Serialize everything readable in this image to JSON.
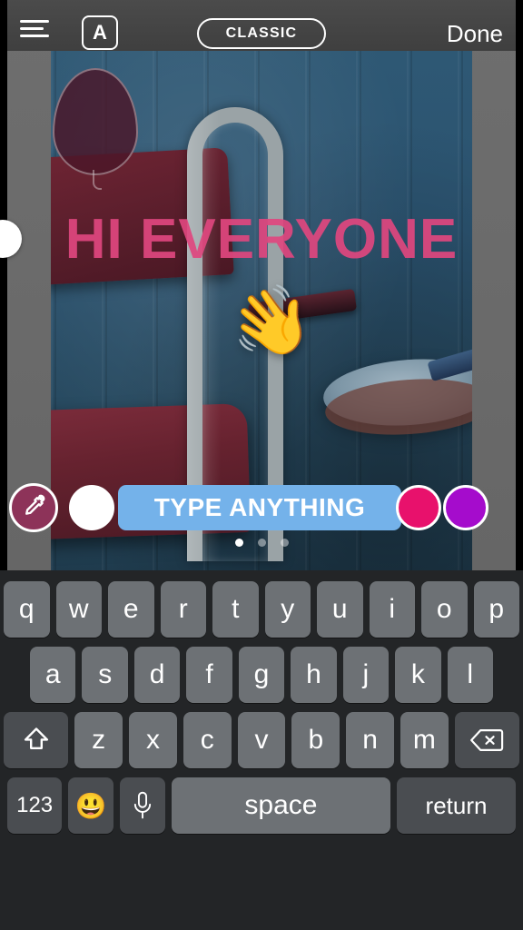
{
  "app": {
    "name": "story-text-editor",
    "mode": "text-entry"
  },
  "topbar": {
    "align_icon": "text-align-icon",
    "letter_label": "A",
    "letter_icon": "text-style-icon",
    "style_label": "CLASSIC",
    "done_label": "Done"
  },
  "canvas": {
    "headline_text": "HI EVERYONE",
    "headline_color": "#e0477f",
    "stickers": [
      {
        "name": "balloon-sticker",
        "glyph": "balloon",
        "color": "#4a1628"
      },
      {
        "name": "waving-hand-sticker",
        "glyph": "👋"
      }
    ],
    "photo_description": "maroon leather chair against blue plank wall"
  },
  "controls": {
    "eyedropper_icon": "eyedropper-icon",
    "eyedropper_color": "#8d3359",
    "type_field_placeholder": "TYPE ANYTHING",
    "type_field_bg": "#74b2ea",
    "swatches": [
      {
        "name": "color-swatch-white",
        "color": "#ffffff",
        "selected": true
      },
      {
        "name": "color-swatch-pink",
        "color": "#e8116c",
        "selected": false
      },
      {
        "name": "color-swatch-purple",
        "color": "#a50ccc",
        "selected": false
      }
    ],
    "page_dots": {
      "count": 3,
      "active": 0
    }
  },
  "keyboard": {
    "row1": [
      "q",
      "w",
      "e",
      "r",
      "t",
      "y",
      "u",
      "i",
      "o",
      "p"
    ],
    "row2": [
      "a",
      "s",
      "d",
      "f",
      "g",
      "h",
      "j",
      "k",
      "l"
    ],
    "row3": [
      "z",
      "x",
      "c",
      "v",
      "b",
      "n",
      "m"
    ],
    "shift_icon": "shift-icon",
    "delete_icon": "backspace-icon",
    "numbers_label": "123",
    "emoji_icon": "emoji-icon",
    "emoji_glyph": "😃",
    "mic_icon": "microphone-icon",
    "space_label": "space",
    "return_label": "return"
  }
}
